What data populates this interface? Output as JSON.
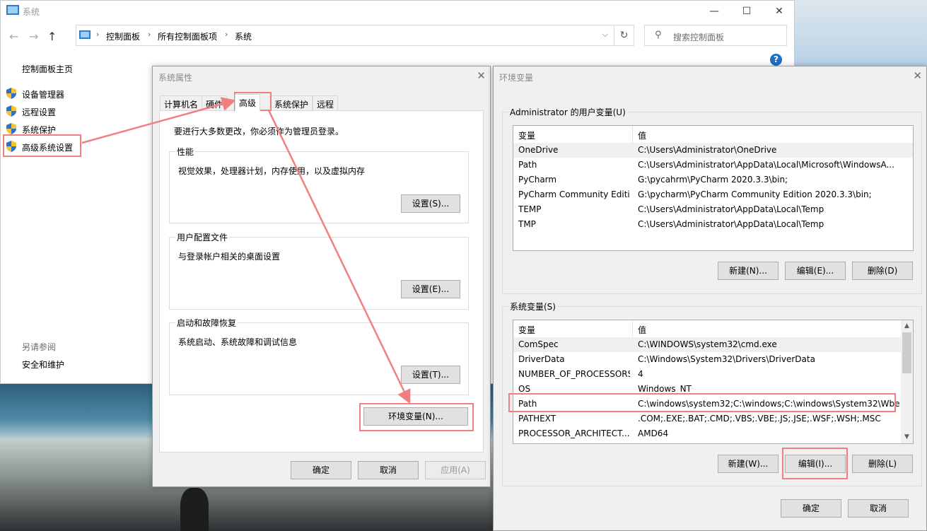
{
  "control_panel": {
    "title": "系统",
    "window_buttons": {
      "minimize": "—",
      "maximize": "☐",
      "close": "✕"
    },
    "nav": {
      "back": "←",
      "forward": "→",
      "up": "↑"
    },
    "breadcrumb": [
      "控制面板",
      "所有控制面板项",
      "系统"
    ],
    "breadcrumb_sep": "›",
    "dropdown": "⌵",
    "refresh": "↻",
    "search_placeholder": "搜索控制面板",
    "help": "?",
    "home": "控制面板主页",
    "links": [
      "设备管理器",
      "远程设置",
      "系统保护",
      "高级系统设置"
    ],
    "see_also": "另请参阅",
    "security": "安全和维护"
  },
  "system_properties": {
    "title": "系统属性",
    "close": "✕",
    "tabs": [
      "计算机名",
      "硬件",
      "高级",
      "系统保护",
      "远程"
    ],
    "active_tab": "高级",
    "admin_note": "要进行大多数更改，你必须作为管理员登录。",
    "groups": [
      {
        "title": "性能",
        "desc": "视觉效果，处理器计划，内存使用，以及虚拟内存",
        "button": "设置(S)..."
      },
      {
        "title": "用户配置文件",
        "desc": "与登录帐户相关的桌面设置",
        "button": "设置(E)..."
      },
      {
        "title": "启动和故障恢复",
        "desc": "系统启动、系统故障和调试信息",
        "button": "设置(T)..."
      }
    ],
    "env_button": "环境变量(N)...",
    "ok": "确定",
    "cancel": "取消",
    "apply": "应用(A)"
  },
  "env_vars": {
    "title": "环境变量",
    "close": "✕",
    "user_group_title": "Administrator 的用户变量(U)",
    "columns": [
      "变量",
      "值"
    ],
    "user_vars": [
      {
        "name": "OneDrive",
        "value": "C:\\Users\\Administrator\\OneDrive"
      },
      {
        "name": "Path",
        "value": "C:\\Users\\Administrator\\AppData\\Local\\Microsoft\\WindowsA..."
      },
      {
        "name": "PyCharm",
        "value": "G:\\pycahrm\\PyCharm 2020.3.3\\bin;"
      },
      {
        "name": "PyCharm Community Editi...",
        "value": "G:\\pycharm\\PyCharm Community Edition 2020.3.3\\bin;"
      },
      {
        "name": "TEMP",
        "value": "C:\\Users\\Administrator\\AppData\\Local\\Temp"
      },
      {
        "name": "TMP",
        "value": "C:\\Users\\Administrator\\AppData\\Local\\Temp"
      }
    ],
    "user_buttons": {
      "new": "新建(N)...",
      "edit": "编辑(E)...",
      "delete": "删除(D)"
    },
    "system_group_title": "系统变量(S)",
    "system_vars": [
      {
        "name": "ComSpec",
        "value": "C:\\WINDOWS\\system32\\cmd.exe"
      },
      {
        "name": "DriverData",
        "value": "C:\\Windows\\System32\\Drivers\\DriverData"
      },
      {
        "name": "NUMBER_OF_PROCESSORS",
        "value": "4"
      },
      {
        "name": "OS",
        "value": "Windows_NT"
      },
      {
        "name": "Path",
        "value": "C:\\windows\\system32;C:\\windows;C:\\windows\\System32\\Wbe..."
      },
      {
        "name": "PATHEXT",
        "value": ".COM;.EXE;.BAT;.CMD;.VBS;.VBE;.JS;.JSE;.WSF;.WSH;.MSC"
      },
      {
        "name": "PROCESSOR_ARCHITECT...",
        "value": "AMD64"
      }
    ],
    "system_buttons": {
      "new": "新建(W)...",
      "edit": "编辑(I)...",
      "delete": "删除(L)"
    },
    "scroll_up": "▲",
    "scroll_down": "▼",
    "ok": "确定",
    "cancel": "取消"
  },
  "colors": {
    "annotation": "#f08080",
    "accent": "#0078d7",
    "help": "#1f6fc5"
  }
}
